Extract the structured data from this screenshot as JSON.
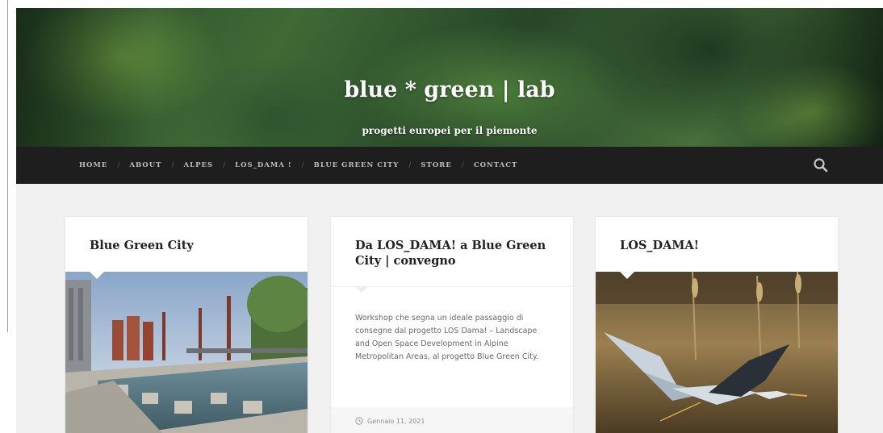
{
  "site": {
    "title": "blue * green | lab",
    "tagline": "progetti europei per il piemonte"
  },
  "nav": {
    "items": [
      "HOME",
      "ABOUT",
      "ALPES",
      "LOS_DAMA !",
      "BLUE GREEN CITY",
      "STORE",
      "CONTACT"
    ],
    "separator": "/",
    "search_icon": "search-icon"
  },
  "posts": [
    {
      "title": "Blue Green City",
      "image": "urban-park-canal-photo"
    },
    {
      "title": "Da LOS_DAMA! a Blue Green City | convegno",
      "excerpt": "Workshop che segna un ideale passaggio di consegne dal progetto LOS Dama! – Landscape and Open Space Development in Alpine Metropolitan Areas, al progetto Blue Green City.",
      "date": "Gennaio 11, 2021",
      "date_icon": "clock-icon"
    },
    {
      "title": "LOS_DAMA!",
      "image": "heron-in-flight-photo"
    }
  ],
  "colors": {
    "navbar": "#1e1e1e",
    "nav_text": "#bdbdbd",
    "content_bg": "#f1f1f1",
    "card_bg": "#ffffff"
  }
}
